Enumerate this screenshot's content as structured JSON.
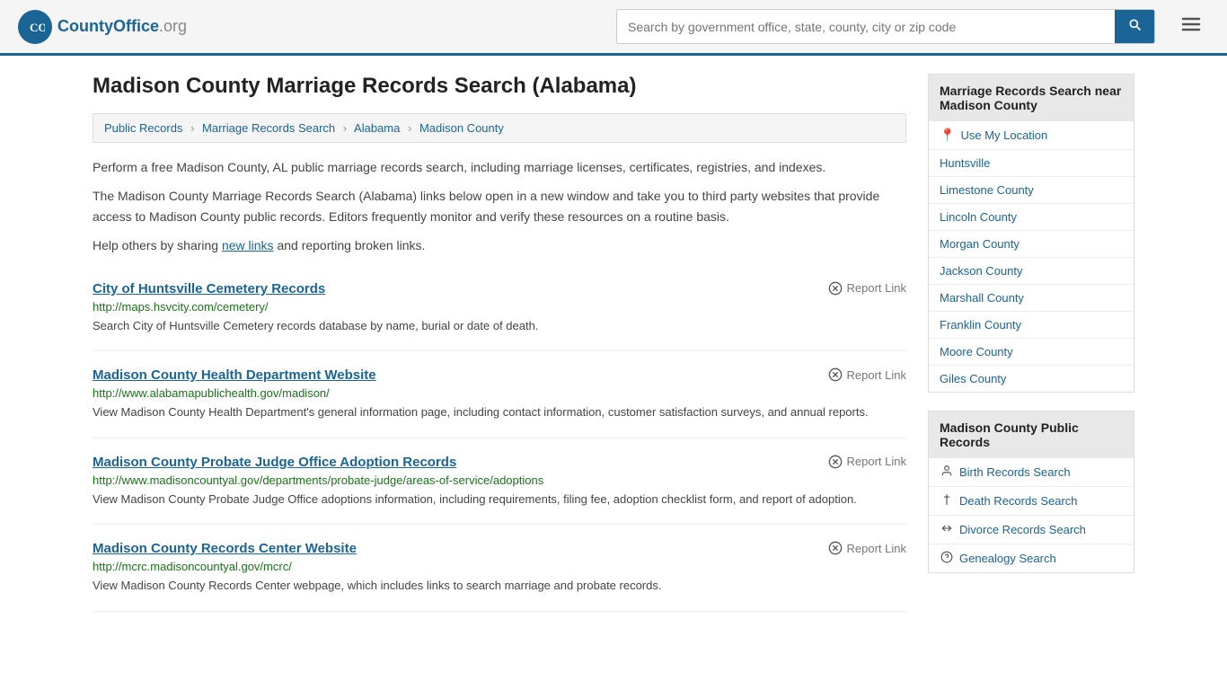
{
  "header": {
    "logo_text": "CountyOffice",
    "logo_org": ".org",
    "search_placeholder": "Search by government office, state, county, city or zip code",
    "search_btn_label": "🔍"
  },
  "page": {
    "title": "Madison County Marriage Records Search (Alabama)",
    "breadcrumb": [
      {
        "label": "Public Records",
        "href": "#"
      },
      {
        "label": "Marriage Records Search",
        "href": "#"
      },
      {
        "label": "Alabama",
        "href": "#"
      },
      {
        "label": "Madison County",
        "href": "#"
      }
    ],
    "intro1": "Perform a free Madison County, AL public marriage records search, including marriage licenses, certificates, registries, and indexes.",
    "intro2_before": "The Madison County Marriage Records Search (Alabama) links below open in a new window and take you to third party websites that provide access to Madison County public records. Editors frequently monitor and verify these resources on a routine basis.",
    "intro3_before": "Help others by sharing ",
    "intro3_link": "new links",
    "intro3_after": " and reporting broken links.",
    "results": [
      {
        "title": "City of Huntsville Cemetery Records",
        "url": "http://maps.hsvcity.com/cemetery/",
        "desc": "Search City of Huntsville Cemetery records database by name, burial or date of death.",
        "report": "Report Link"
      },
      {
        "title": "Madison County Health Department Website",
        "url": "http://www.alabamapublichealth.gov/madison/",
        "desc": "View Madison County Health Department's general information page, including contact information, customer satisfaction surveys, and annual reports.",
        "report": "Report Link"
      },
      {
        "title": "Madison County Probate Judge Office Adoption Records",
        "url": "http://www.madisoncountyal.gov/departments/probate-judge/areas-of-service/adoptions",
        "desc": "View Madison County Probate Judge Office adoptions information, including requirements, filing fee, adoption checklist form, and report of adoption.",
        "report": "Report Link"
      },
      {
        "title": "Madison County Records Center Website",
        "url": "http://mcrc.madisoncountyal.gov/mcrc/",
        "desc": "View Madison County Records Center webpage, which includes links to search marriage and probate records.",
        "report": "Report Link"
      }
    ]
  },
  "sidebar": {
    "nearby_header": "Marriage Records Search near Madison County",
    "use_location": "Use My Location",
    "nearby_items": [
      {
        "label": "Huntsville"
      },
      {
        "label": "Limestone County"
      },
      {
        "label": "Lincoln County"
      },
      {
        "label": "Morgan County"
      },
      {
        "label": "Jackson County"
      },
      {
        "label": "Marshall County"
      },
      {
        "label": "Franklin County"
      },
      {
        "label": "Moore County"
      },
      {
        "label": "Giles County"
      }
    ],
    "public_records_header": "Madison County Public Records",
    "public_records_items": [
      {
        "icon": "👤",
        "label": "Birth Records Search"
      },
      {
        "icon": "✝",
        "label": "Death Records Search"
      },
      {
        "icon": "↔",
        "label": "Divorce Records Search"
      },
      {
        "icon": "?",
        "label": "Genealogy Search"
      }
    ]
  }
}
